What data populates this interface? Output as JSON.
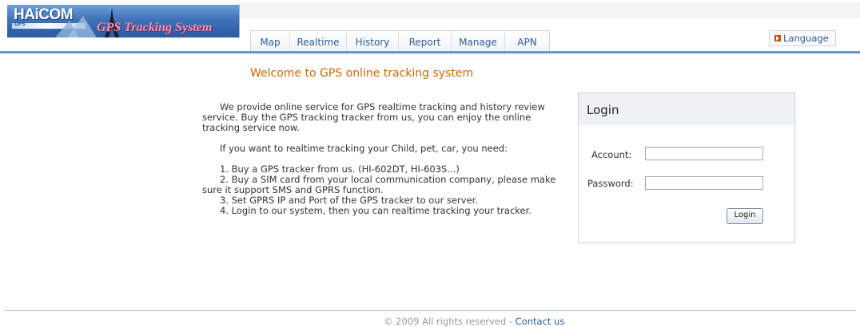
{
  "header": {
    "logo_brand": "HAiCOM",
    "logo_brand_sub": "GPS",
    "logo_title": "GPS Tracking System"
  },
  "nav": {
    "items": [
      "Map",
      "Realtime",
      "History",
      "Report",
      "Manage",
      "APN"
    ]
  },
  "language": {
    "label": "Language"
  },
  "main": {
    "welcome": "Welcome to GPS online tracking system",
    "intro": "We provide online service for GPS realtime tracking and history review service. Buy the GPS tracking tracker from us, you can enjoy the online tracking service now.",
    "need": "If you want to realtime tracking your Child, pet, car, you need:",
    "steps": [
      "1. Buy a GPS tracker from us. (HI-602DT, HI-603S...)",
      "2. Buy a SIM card from your local communication company, please make sure it support SMS and GPRS function.",
      "3. Set GPRS IP and Port of the GPS tracker to our server.",
      "4. Login to our system, then you can realtime tracking your tracker."
    ]
  },
  "login": {
    "title": "Login",
    "account_label": "Account:",
    "account_value": "",
    "password_label": "Password:",
    "password_value": "",
    "button_label": "Login"
  },
  "footer": {
    "copyright": "© 2009  All rights reserved  - ",
    "contact_label": "Contact us"
  },
  "colors": {
    "accent": "#2e5c95",
    "welcome": "#cc6a00",
    "header_line": "#4e7fc0"
  }
}
